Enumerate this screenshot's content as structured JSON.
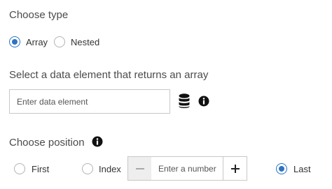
{
  "choose_type": {
    "title": "Choose type",
    "options": [
      {
        "label": "Array",
        "selected": true
      },
      {
        "label": "Nested",
        "selected": false
      }
    ]
  },
  "data_element": {
    "title": "Select a data element that returns an array",
    "input_value": "",
    "input_placeholder": "Enter data element",
    "database_icon": "database-icon",
    "info_icon": "info-icon"
  },
  "choose_position": {
    "title": "Choose position",
    "info_icon": "info-icon",
    "options": [
      {
        "label": "First",
        "selected": false
      },
      {
        "label": "Index",
        "selected": false
      },
      {
        "label": "Last",
        "selected": true
      }
    ],
    "number_input": {
      "value": "",
      "placeholder": "Enter a number",
      "decrement_icon": "minus-icon",
      "increment_icon": "plus-icon"
    }
  },
  "colors": {
    "accent": "#2d73c4",
    "text": "#4b4b4b",
    "border": "#c8c8c8"
  }
}
